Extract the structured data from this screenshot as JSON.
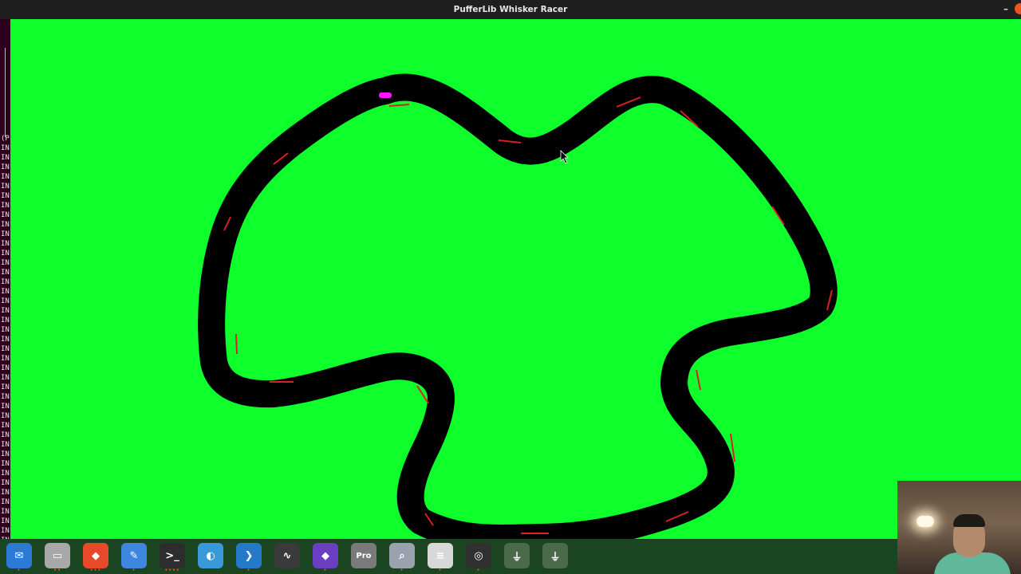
{
  "window": {
    "title": "PufferLib Whisker Racer",
    "minimize_glyph": "–"
  },
  "terminal": {
    "lines": [
      "(P",
      "IN",
      "IN",
      "IN",
      "IN",
      "IN",
      "IN",
      "IN",
      "IN",
      "IN",
      "IN",
      "IN",
      "IN",
      "IN",
      "IN",
      "IN",
      "IN",
      "IN",
      "IN",
      "IN",
      "IN",
      "IN",
      "IN",
      "IN",
      "IN",
      "IN",
      "IN",
      "IN",
      "IN",
      "IN",
      "IN",
      "IN",
      "IN",
      "IN",
      "IN",
      "IN",
      "IN",
      "IN",
      "IN",
      "IN",
      "IN",
      "IN",
      "IN",
      "IN"
    ]
  },
  "game": {
    "background_color": "#0eff2b",
    "track_color": "#000000",
    "marker_color": "#d8202a",
    "car_color": "#ff14ff"
  },
  "dock": {
    "items": [
      {
        "name": "dock-thunderbird",
        "icon": "thunderbird-icon",
        "color": "#2a7ad6",
        "glyph": "✉",
        "running": "•"
      },
      {
        "name": "dock-files",
        "icon": "folder-icon",
        "color": "#a8a8a8",
        "glyph": "▭",
        "running": "••"
      },
      {
        "name": "dock-brave",
        "icon": "lion-icon",
        "color": "#e8492a",
        "glyph": "◆",
        "running": "•••"
      },
      {
        "name": "dock-text-editor",
        "icon": "pencil-icon",
        "color": "#3d87e0",
        "glyph": "✎",
        "running": "•"
      },
      {
        "name": "dock-terminal",
        "icon": "terminal-icon",
        "color": "#2d2d2d",
        "glyph": ">_",
        "running": "••••"
      },
      {
        "name": "dock-photo",
        "icon": "image-icon",
        "color": "#3a9ad9",
        "glyph": "◐",
        "running": ""
      },
      {
        "name": "dock-vscode",
        "icon": "code-icon",
        "color": "#2479c9",
        "glyph": "❯",
        "running": "•"
      },
      {
        "name": "dock-system-monitor",
        "icon": "pulse-icon",
        "color": "#3a3a3a",
        "glyph": "∿",
        "running": ""
      },
      {
        "name": "dock-obsidian",
        "icon": "crystal-icon",
        "color": "#6c3fc2",
        "glyph": "◆",
        "running": "•"
      },
      {
        "name": "dock-google-earth",
        "icon": "globe-icon",
        "color": "#7a7a7a",
        "glyph": "Pro",
        "running": ""
      },
      {
        "name": "dock-magnifier",
        "icon": "magnifier-icon",
        "color": "#9aa3ad",
        "glyph": "⌕",
        "running": "•"
      },
      {
        "name": "dock-document-viewer",
        "icon": "document-icon",
        "color": "#d8d8d8",
        "glyph": "≡",
        "running": "•"
      },
      {
        "name": "dock-obs",
        "icon": "obs-icon",
        "color": "#303030",
        "glyph": "◎",
        "running": "•"
      },
      {
        "name": "dock-usb-drive-1",
        "icon": "usb-icon",
        "color": "#4a6a4a",
        "glyph": "⏚",
        "running": ""
      },
      {
        "name": "dock-usb-drive-2",
        "icon": "usb-icon",
        "color": "#4a6a4a",
        "glyph": "⏚",
        "running": ""
      }
    ]
  }
}
